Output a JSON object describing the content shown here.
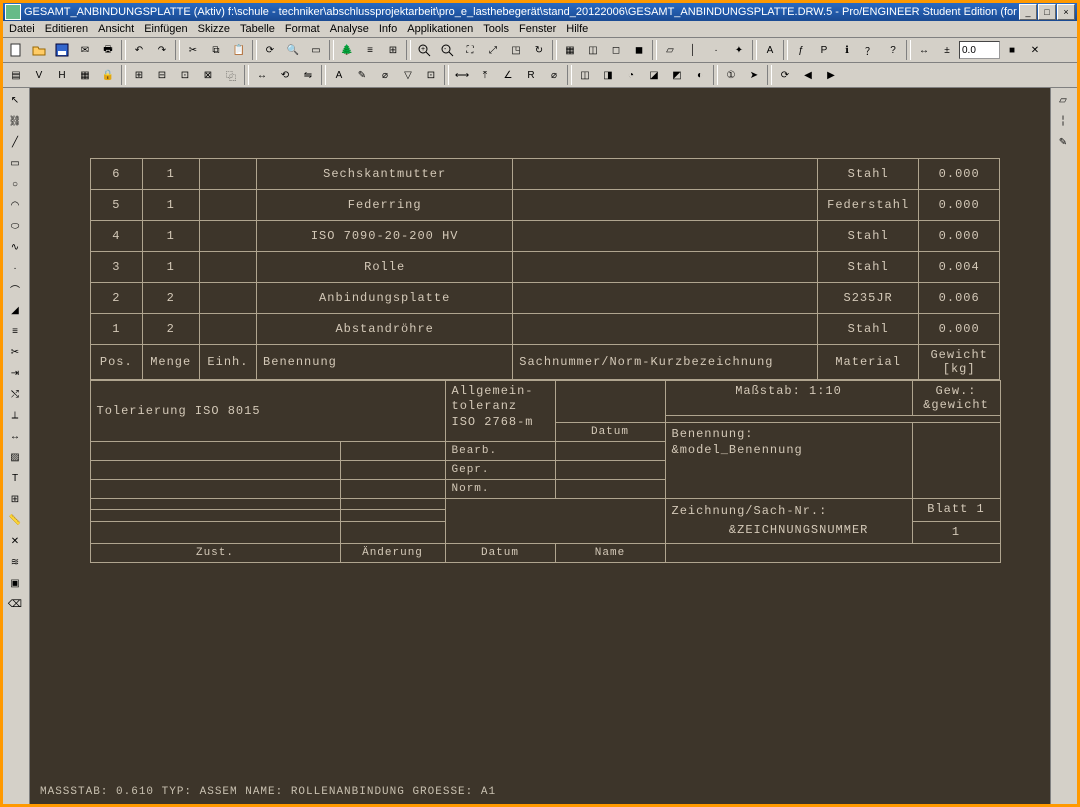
{
  "title": "GESAMT_ANBINDUNGSPLATTE (Aktiv) f:\\schule - techniker\\abschlussprojektarbeit\\pro_e_lasthebegerät\\stand_20122006\\GESAMT_ANBINDUNGSPLATTE.DRW.5 - Pro/ENGINEER Student Edition (for educational use only)",
  "menu": [
    "Datei",
    "Editieren",
    "Ansicht",
    "Einfügen",
    "Skizze",
    "Tabelle",
    "Format",
    "Analyse",
    "Info",
    "Applikationen",
    "Tools",
    "Fenster",
    "Hilfe"
  ],
  "bom_headers": {
    "pos": "Pos.",
    "menge": "Menge",
    "einh": "Einh.",
    "benennung": "Benennung",
    "sachnr": "Sachnummer/Norm-Kurzbezeichnung",
    "material": "Material",
    "gewicht": "Gewicht [kg]"
  },
  "bom_rows": [
    {
      "pos": "6",
      "menge": "1",
      "einh": "",
      "benennung": "Sechskantmutter",
      "sachnr": "",
      "material": "Stahl",
      "gewicht": "0.000"
    },
    {
      "pos": "5",
      "menge": "1",
      "einh": "",
      "benennung": "Federring",
      "sachnr": "",
      "material": "Federstahl",
      "gewicht": "0.000"
    },
    {
      "pos": "4",
      "menge": "1",
      "einh": "",
      "benennung": "ISO 7090-20-200 HV",
      "sachnr": "",
      "material": "Stahl",
      "gewicht": "0.000"
    },
    {
      "pos": "3",
      "menge": "1",
      "einh": "",
      "benennung": "Rolle",
      "sachnr": "",
      "material": "Stahl",
      "gewicht": "0.004"
    },
    {
      "pos": "2",
      "menge": "2",
      "einh": "",
      "benennung": "Anbindungsplatte",
      "sachnr": "",
      "material": "S235JR",
      "gewicht": "0.006"
    },
    {
      "pos": "1",
      "menge": "2",
      "einh": "",
      "benennung": "Abstandröhre",
      "sachnr": "",
      "material": "Stahl",
      "gewicht": "0.000"
    }
  ],
  "titleblock": {
    "tolerierung": "Tolerierung  ISO 8015",
    "allgtol_l1": "Allgemein-",
    "allgtol_l2": "toleranz",
    "allgtol_l3": "ISO 2768-m",
    "massstab": "Maßstab: 1:10",
    "gewicht": "Gew.: &gewicht",
    "datum_h": "Datum",
    "name_h": "Name",
    "bearb": "Bearb.",
    "gepr": "Gepr.",
    "norm": "Norm.",
    "benennung_l": "Benennung:",
    "benennung_v": "&model_Benennung",
    "zeich_l": "Zeichnung/Sach-Nr.:",
    "zeich_v": "&ZEICHNUNGSNUMMER",
    "blatt": "Blatt  1",
    "blatt_n": "1",
    "zust": "Zust.",
    "aenderung": "Änderung",
    "datum": "Datum",
    "name": "Name"
  },
  "status": "MASSSTAB: 0.610    TYP: ASSEM    NAME: ROLLENANBINDUNG    GROESSE: A1",
  "spin_val": "0.0"
}
